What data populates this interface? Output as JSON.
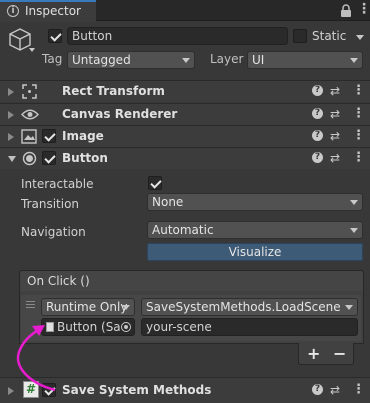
{
  "tab": {
    "title": "Inspector"
  },
  "header": {
    "object_name": "Button",
    "static_label": "Static",
    "tag_label": "Tag",
    "tag_value": "Untagged",
    "layer_label": "Layer",
    "layer_value": "UI"
  },
  "components": {
    "rect_transform": "Rect Transform",
    "canvas_renderer": "Canvas Renderer",
    "image": "Image",
    "button": "Button",
    "save_system": "Save System Methods"
  },
  "button_props": {
    "interactable_label": "Interactable",
    "interactable_checked": true,
    "transition_label": "Transition",
    "transition_value": "None",
    "navigation_label": "Navigation",
    "navigation_value": "Automatic",
    "visualize_label": "Visualize"
  },
  "on_click": {
    "title": "On Click ()",
    "runtime_value": "Runtime Only",
    "function_value": "SaveSystemMethods.LoadScene",
    "object_value": "Button (Sa",
    "argument_value": "your-scene",
    "add_label": "+",
    "remove_label": "−"
  },
  "colors": {
    "background": "#383838",
    "accent_visualize": "#3d5a77",
    "annotation_arrow": "#e81ccf"
  },
  "icons": {
    "tab": "info-icon",
    "lock": "lock-icon",
    "menu": "kebab-icon",
    "gameobject": "cube-icon",
    "rect_transform": "rect-transform-icon",
    "canvas_renderer": "eye-icon",
    "image": "image-icon",
    "button": "button-icon",
    "script": "hash-script-icon",
    "help": "help-icon",
    "presets": "presets-icon"
  }
}
